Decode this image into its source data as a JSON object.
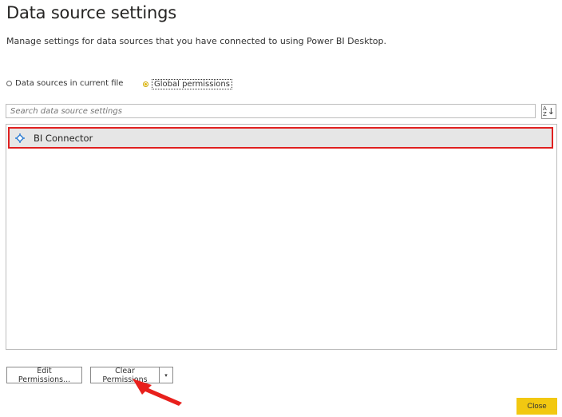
{
  "dialog": {
    "title": "Data source settings",
    "subtitle": "Manage settings for data sources that you have connected to using Power BI Desktop."
  },
  "scope": {
    "current_file_label": "Data sources in current file",
    "global_label": "Global permissions",
    "selected": "global"
  },
  "search": {
    "placeholder": "Search data source settings",
    "value": ""
  },
  "sort_button": {
    "top": "A",
    "bottom": "Z",
    "arrow": "↓"
  },
  "sources": [
    {
      "label": "BI Connector",
      "icon": "connector-icon",
      "selected": true
    }
  ],
  "buttons": {
    "edit_permissions": "Edit Permissions...",
    "clear_permissions": "Clear Permissions",
    "dropdown_glyph": "▾",
    "close": "Close"
  },
  "colors": {
    "accent_yellow": "#f2c811",
    "highlight_red": "#e02020",
    "selected_row": "#e6e6e6"
  }
}
